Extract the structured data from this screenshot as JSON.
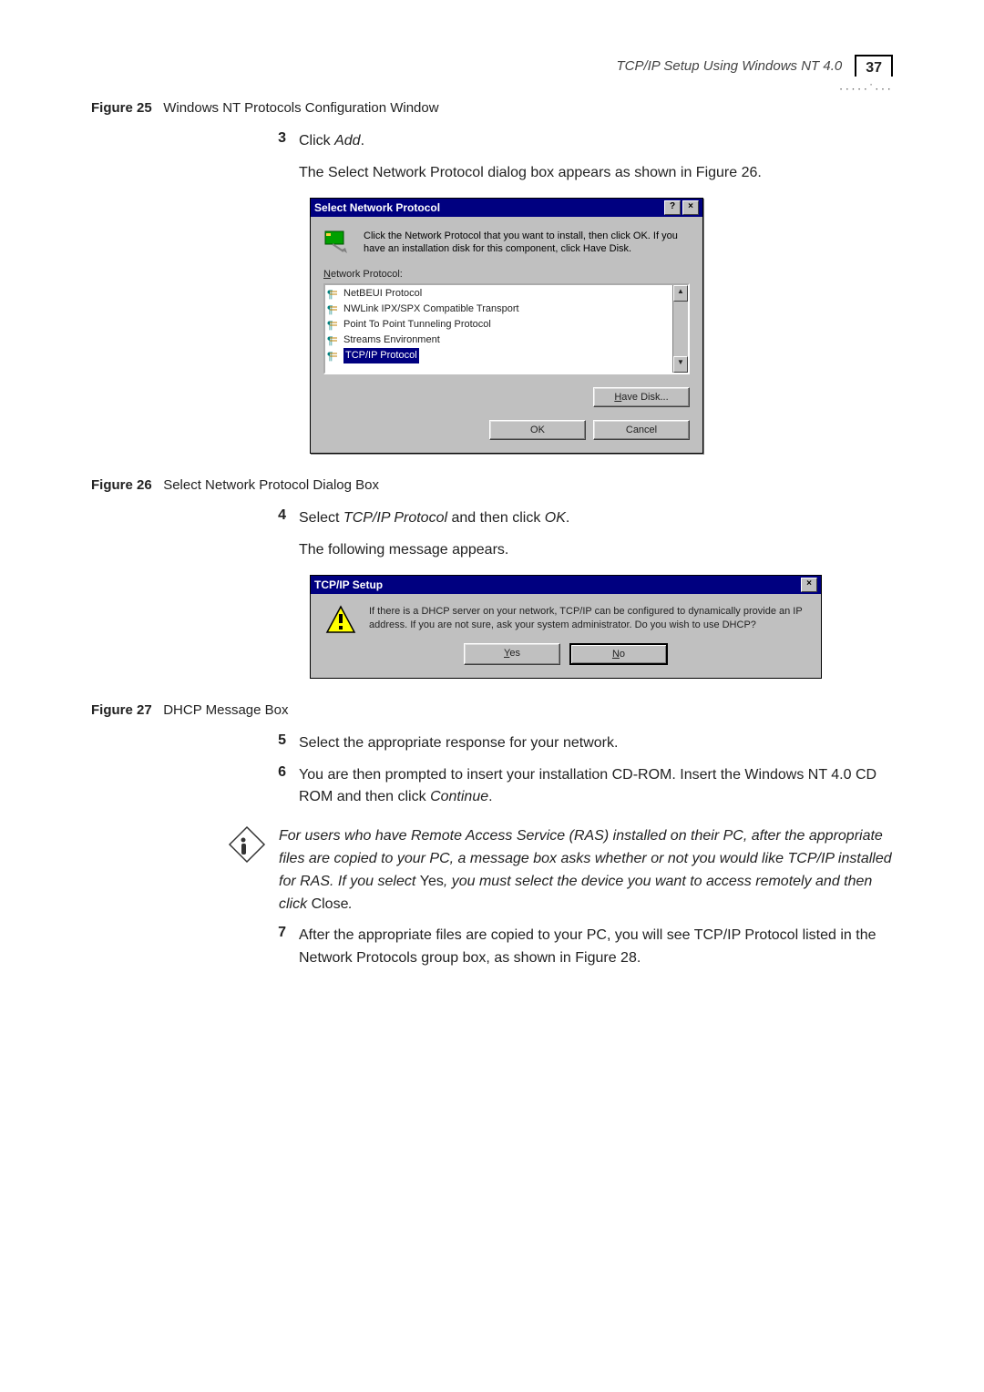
{
  "header": {
    "section_title": "TCP/IP Setup Using Windows NT 4.0",
    "page_number": "37"
  },
  "figure25": {
    "label": "Figure 25",
    "caption": "Windows NT Protocols Configuration Window"
  },
  "step3": {
    "num": "3",
    "text_pre": "Click ",
    "text_em": "Add",
    "text_post": ".",
    "follow": "The Select Network Protocol dialog box appears as shown in Figure 26."
  },
  "dlg1": {
    "title": "Select Network Protocol",
    "help_btn": "?",
    "close_btn": "×",
    "intro": "Click the Network Protocol that you want to install, then click OK.  If you have an installation disk for this component, click Have Disk.",
    "list_label_u": "N",
    "list_label_rest": "etwork Protocol:",
    "items": [
      "NetBEUI Protocol",
      "NWLink IPX/SPX Compatible Transport",
      "Point To Point Tunneling Protocol",
      "Streams Environment",
      "TCP/IP Protocol"
    ],
    "scroll_up": "▲",
    "scroll_down": "▼",
    "have_disk_u": "H",
    "have_disk_rest": "ave Disk...",
    "ok": "OK",
    "cancel": "Cancel"
  },
  "figure26": {
    "label": "Figure 26",
    "caption": "Select Network Protocol Dialog Box"
  },
  "step4": {
    "num": "4",
    "pre": "Select ",
    "em1": "TCP/IP Protocol",
    "mid": " and then click ",
    "em2": "OK",
    "post": ".",
    "follow": "The following message appears."
  },
  "dlg2": {
    "title": "TCP/IP Setup",
    "close_btn": "×",
    "msg": "If there is a DHCP server on your network, TCP/IP can be configured to dynamically provide an IP address.  If you are not sure, ask your system administrator.  Do you wish to use DHCP?",
    "yes_u": "Y",
    "yes_rest": "es",
    "no_u": "N",
    "no_rest": "o"
  },
  "figure27": {
    "label": "Figure 27",
    "caption": "DHCP Message Box"
  },
  "step5": {
    "num": "5",
    "text": "Select the appropriate response for your network."
  },
  "step6": {
    "num": "6",
    "pre": "You are then prompted to insert your installation CD-ROM. Insert the Windows NT 4.0 CD ROM and then click ",
    "em": "Continue",
    "post": "."
  },
  "info": {
    "l1": "For users who have Remote Access Service (RAS) installed on their PC, after the appropriate files are copied to your PC, a message box asks whether or not you would like TCP/IP installed for RAS. If you select ",
    "roman1": "Yes",
    "l2": ", you must select the device you want to access remotely and then click ",
    "roman2": "Close",
    "l3": "."
  },
  "step7": {
    "num": "7",
    "text": "After the appropriate files are copied to your PC, you will see TCP/IP Protocol listed in the Network Protocols group box, as shown in Figure 28."
  }
}
